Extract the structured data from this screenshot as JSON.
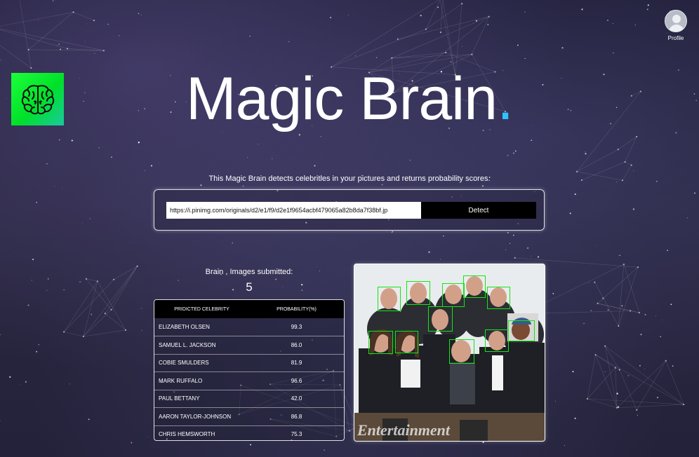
{
  "profile": {
    "label": "Profile",
    "icon": "avatar-icon"
  },
  "logo": {
    "icon": "brain-icon",
    "gradient_from": "#1dff3a",
    "gradient_to": "#19c9a0"
  },
  "title": {
    "main": "Magic Brain",
    "dot": ".",
    "dot_color": "#2ec5ff"
  },
  "subtitle": "This Magic Brain detects celebrities in your pictures and returns probability scores.",
  "url_form": {
    "value": "https://i.pinimg.com/originals/d2/e1/f9/d2e1f9654acbf479065a82b8da7f38bf.jp",
    "detect_label": "Detect"
  },
  "stats": {
    "label": "Brain , Images submitted:",
    "count": "5"
  },
  "table": {
    "headers": [
      "PRIDICTED CELEBRITY",
      "PROBABILITY(%)"
    ],
    "rows": [
      {
        "name": "ELIZABETH OLSEN",
        "probability": "99.3"
      },
      {
        "name": "SAMUEL L. JACKSON",
        "probability": "86.0"
      },
      {
        "name": "COBIE SMULDERS",
        "probability": "81.9"
      },
      {
        "name": "MARK RUFFALO",
        "probability": "96.6"
      },
      {
        "name": "PAUL BETTANY",
        "probability": "42.0"
      },
      {
        "name": "AARON TAYLOR-JOHNSON",
        "probability": "86.8"
      },
      {
        "name": "CHRIS HEMSWORTH",
        "probability": "75.3"
      }
    ]
  },
  "image": {
    "watermark": "Entertainment",
    "face_box_color": "#12e612",
    "faces_detected": 11
  }
}
